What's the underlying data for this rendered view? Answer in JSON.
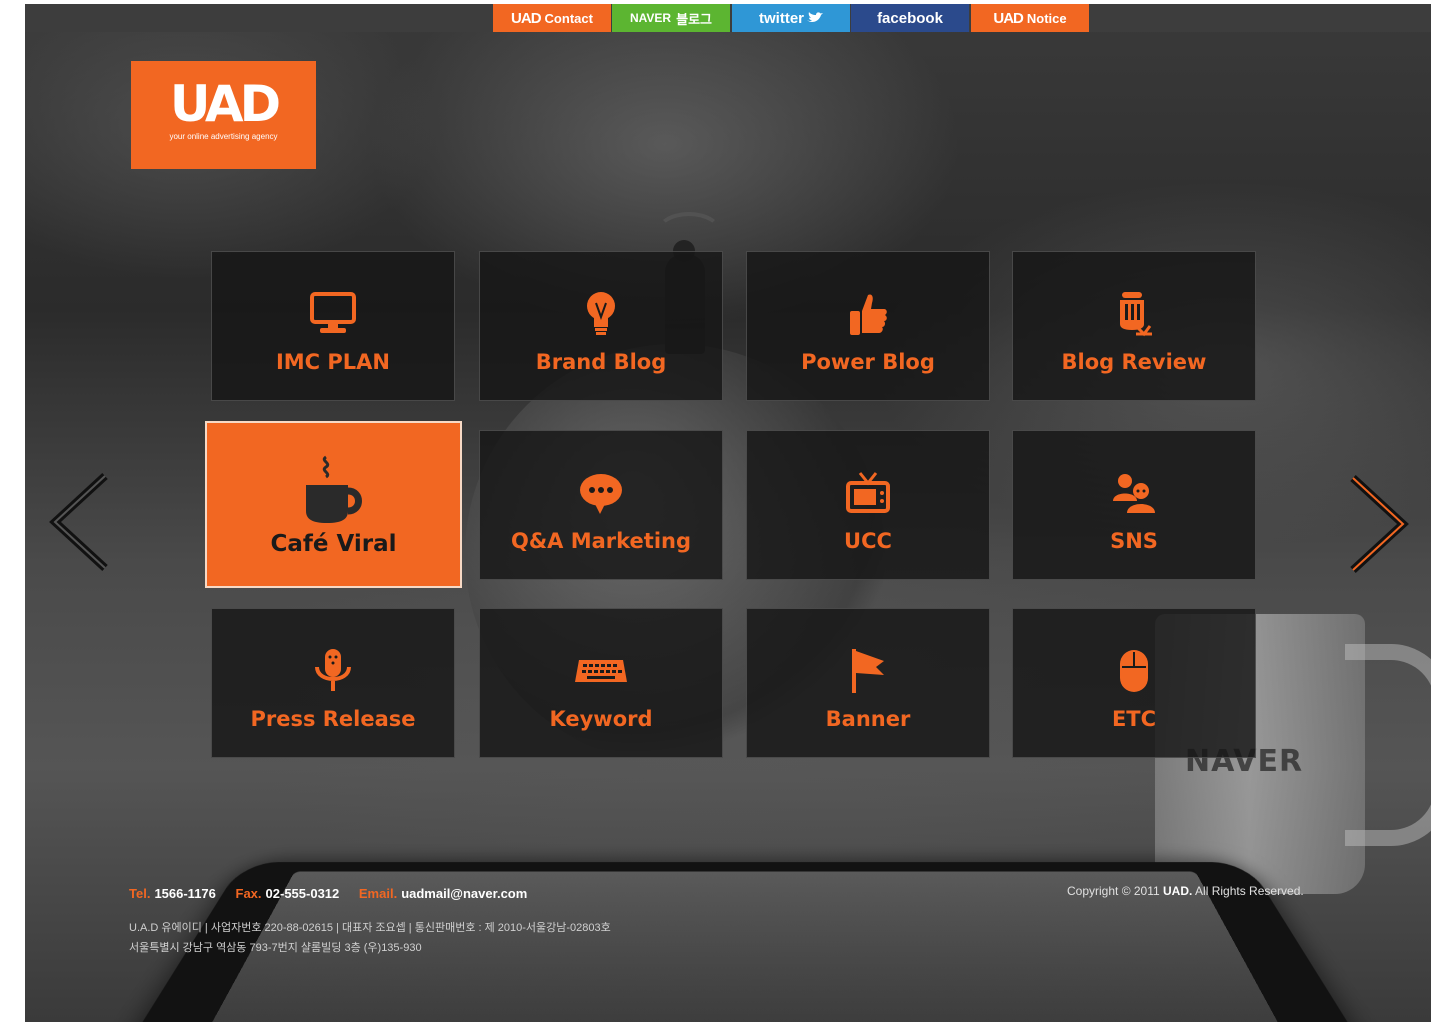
{
  "topbar": {
    "links": [
      {
        "logo": "UAD",
        "label": "Contact",
        "color": "#f26722"
      },
      {
        "logo": "NAVER",
        "label": "블로그",
        "color": "#5cb531"
      },
      {
        "logo": "",
        "label": "twitter",
        "color": "#2f97d6"
      },
      {
        "logo": "",
        "label": "facebook",
        "color": "#2b4a8c"
      },
      {
        "logo": "UAD",
        "label": "Notice",
        "color": "#f26722"
      }
    ]
  },
  "brand": {
    "logo": "UAD",
    "tagline": "your online advertising agency",
    "accent": "#f26722"
  },
  "services": [
    {
      "label": "IMC PLAN",
      "icon": "monitor-icon"
    },
    {
      "label": "Brand Blog",
      "icon": "lightbulb-icon"
    },
    {
      "label": "Power Blog",
      "icon": "thumbs-up-icon"
    },
    {
      "label": "Blog Review",
      "icon": "pencil-cup-icon"
    },
    {
      "label": "Café Viral",
      "icon": "coffee-cup-icon",
      "active": true
    },
    {
      "label": "Q&A Marketing",
      "icon": "speech-bubble-icon"
    },
    {
      "label": "UCC",
      "icon": "tv-icon"
    },
    {
      "label": "SNS",
      "icon": "people-icon"
    },
    {
      "label": "Press Release",
      "icon": "microphone-icon"
    },
    {
      "label": "Keyword",
      "icon": "keyboard-icon"
    },
    {
      "label": "Banner",
      "icon": "flag-icon"
    },
    {
      "label": "ETC",
      "icon": "mouse-icon"
    }
  ],
  "background": {
    "watermark": "NAVER"
  },
  "footer": {
    "tel_label": "Tel.",
    "tel": "1566-1176",
    "fax_label": "Fax.",
    "fax": "02-555-0312",
    "email_label": "Email.",
    "email": "uadmail@naver.com",
    "info_line1": "U.A.D 유에이디  |  사업자번호 220-88-02615  |  대표자 조요셉  |  통신판매번호 : 제 2010-서울강남-02803호",
    "info_line2": "서울특별시 강남구 역삼동 793-7번지 샬롬빌딩 3층 (우)135-930",
    "copyright_pre": "Copyright © 2011",
    "copyright_brand": "UAD.",
    "copyright_post": "All Rights Reserved."
  }
}
